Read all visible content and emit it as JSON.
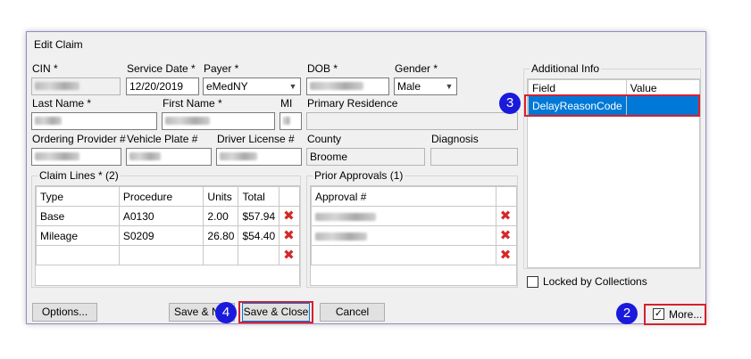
{
  "window": {
    "title": "Edit Claim"
  },
  "fields": {
    "cin_label": "CIN *",
    "service_date_label": "Service Date *",
    "service_date_value": "12/20/2019",
    "payer_label": "Payer *",
    "payer_value": "eMedNY",
    "dob_label": "DOB *",
    "gender_label": "Gender *",
    "gender_value": "Male",
    "last_name_label": "Last Name *",
    "first_name_label": "First Name *",
    "mi_label": "MI",
    "primary_residence_label": "Primary Residence",
    "ordering_provider_label": "Ordering Provider #",
    "vehicle_plate_label": "Vehicle Plate #",
    "driver_license_label": "Driver License #",
    "county_label": "County",
    "county_value": "Broome",
    "diagnosis_label": "Diagnosis"
  },
  "claim_lines": {
    "title": "Claim Lines * (2)",
    "headers": [
      "Type",
      "Procedure",
      "Units",
      "Total"
    ],
    "rows": [
      {
        "type": "Base",
        "procedure": "A0130",
        "units": "2.00",
        "total": "$57.94"
      },
      {
        "type": "Mileage",
        "procedure": "S0209",
        "units": "26.80",
        "total": "$54.40"
      }
    ]
  },
  "prior_approvals": {
    "title": "Prior Approvals (1)",
    "header": "Approval #"
  },
  "additional_info": {
    "title": "Additional Info",
    "headers": [
      "Field",
      "Value"
    ],
    "rows": [
      {
        "field": "DelayReasonCode",
        "value": ""
      }
    ]
  },
  "locked_label": "Locked by Collections",
  "buttons": {
    "options": "Options...",
    "save_new": "Save & N",
    "save_close": "Save & Close",
    "cancel": "Cancel",
    "more": "More..."
  },
  "callouts": {
    "two": "2",
    "three": "3",
    "four": "4"
  },
  "colors": {
    "callout": "#1a1adc",
    "highlight": "#d6202d",
    "selection": "#0078d7",
    "delete": "#d62828"
  }
}
